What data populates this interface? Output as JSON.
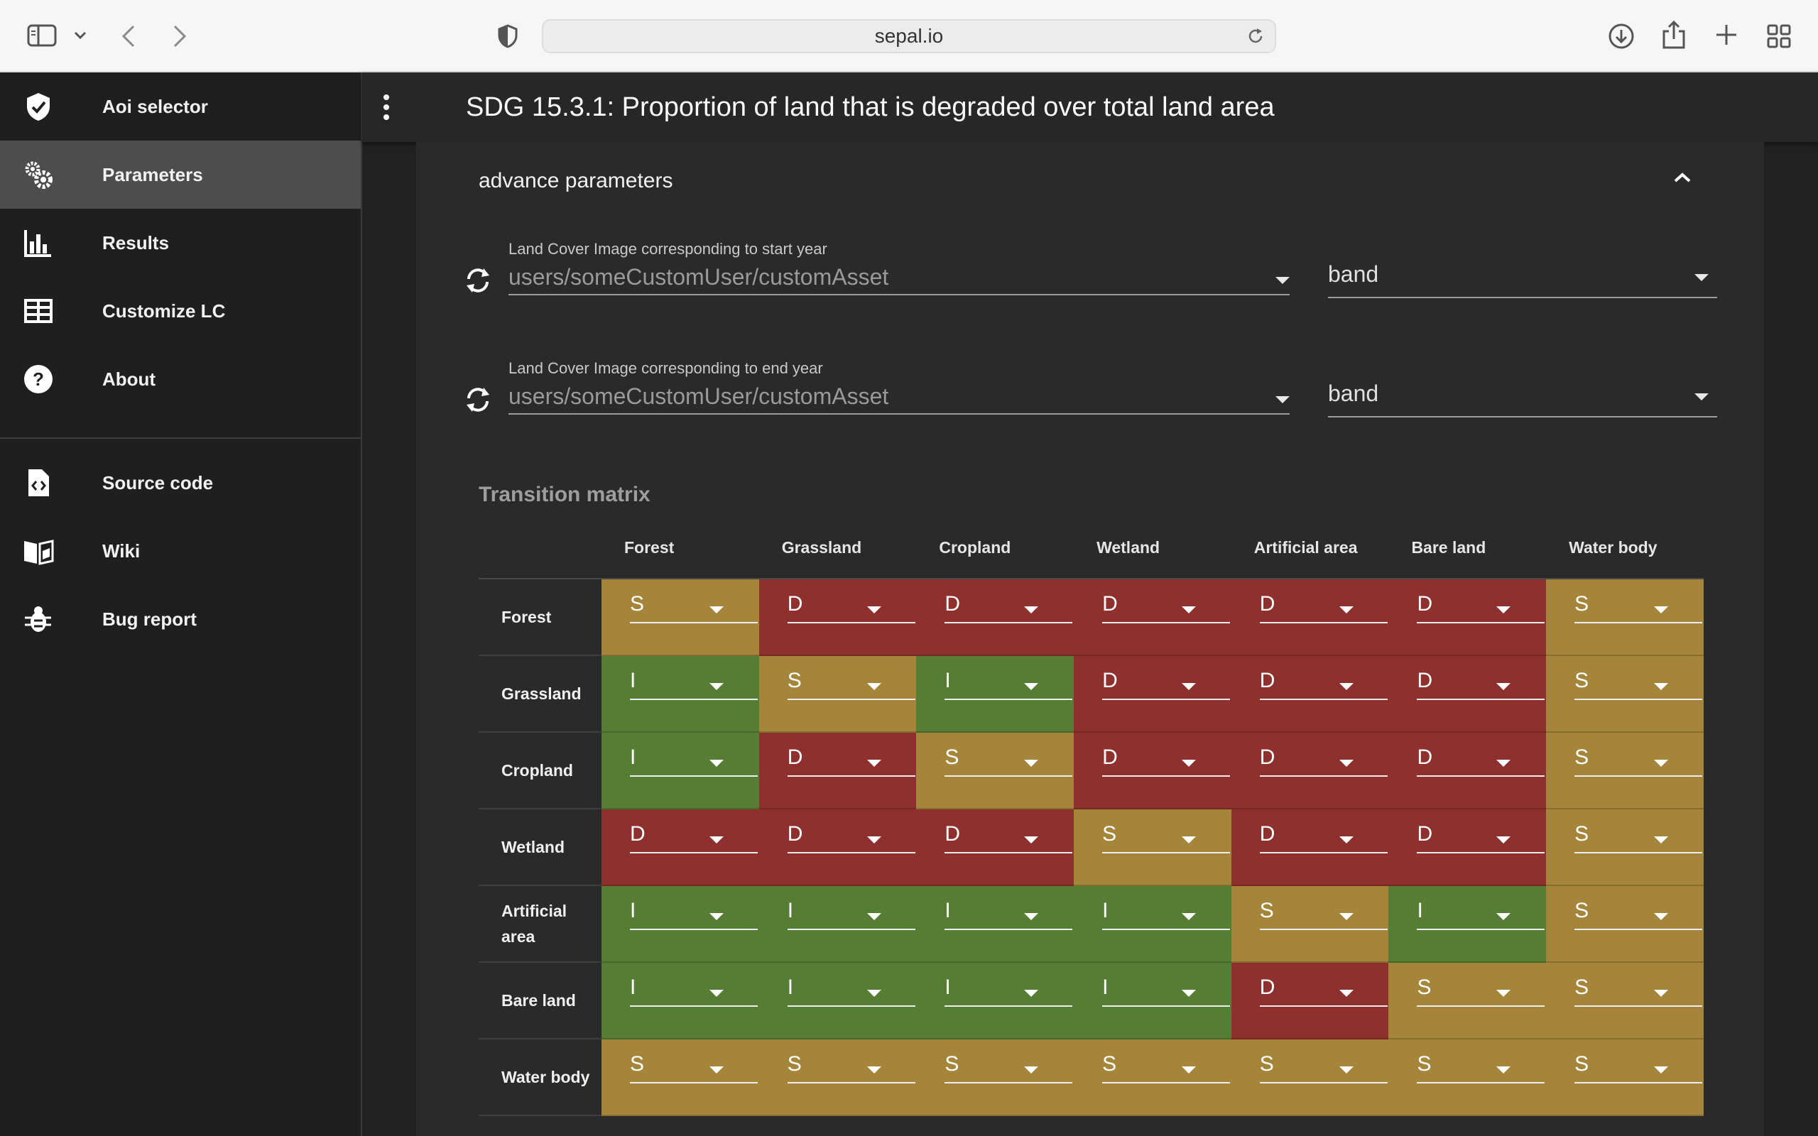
{
  "browser": {
    "url": "sepal.io"
  },
  "sidebar": {
    "items": [
      {
        "label": "Aoi selector",
        "icon": "check-badge-icon",
        "active": false
      },
      {
        "label": "Parameters",
        "icon": "gears-icon",
        "active": true
      },
      {
        "label": "Results",
        "icon": "bar-chart-icon",
        "active": false
      },
      {
        "label": "Customize LC",
        "icon": "table-icon",
        "active": false
      },
      {
        "label": "About",
        "icon": "help-circle-icon",
        "active": false
      }
    ],
    "links": [
      {
        "label": "Source code",
        "icon": "code-file-icon"
      },
      {
        "label": "Wiki",
        "icon": "book-icon"
      },
      {
        "label": "Bug report",
        "icon": "bug-icon"
      }
    ]
  },
  "appbar": {
    "title": "SDG 15.3.1: Proportion of land that is degraded over total land area"
  },
  "panel": {
    "section_title": "advance parameters",
    "start_image": {
      "label": "Land Cover Image corresponding to start year",
      "value": "users/someCustomUser/customAsset",
      "band": "band"
    },
    "end_image": {
      "label": "Land Cover Image corresponding to end year",
      "value": "users/someCustomUser/customAsset",
      "band": "band"
    },
    "matrix_title": "Transition matrix"
  },
  "colors": {
    "S": "#a4853a",
    "D": "#8e302d",
    "I": "#557e34",
    "active_nav": "#4d4d4d"
  },
  "matrix": {
    "columns": [
      "Forest",
      "Grassland",
      "Cropland",
      "Wetland",
      "Artificial area",
      "Bare land",
      "Water body"
    ],
    "rows": [
      {
        "name": "Forest",
        "values": [
          "S",
          "D",
          "D",
          "D",
          "D",
          "D",
          "S"
        ]
      },
      {
        "name": "Grassland",
        "values": [
          "I",
          "S",
          "I",
          "D",
          "D",
          "D",
          "S"
        ]
      },
      {
        "name": "Cropland",
        "values": [
          "I",
          "D",
          "S",
          "D",
          "D",
          "D",
          "S"
        ]
      },
      {
        "name": "Wetland",
        "values": [
          "D",
          "D",
          "D",
          "S",
          "D",
          "D",
          "S"
        ]
      },
      {
        "name": "Artificial area",
        "values": [
          "I",
          "I",
          "I",
          "I",
          "S",
          "I",
          "S"
        ]
      },
      {
        "name": "Bare land",
        "values": [
          "I",
          "I",
          "I",
          "I",
          "D",
          "S",
          "S"
        ]
      },
      {
        "name": "Water body",
        "values": [
          "S",
          "S",
          "S",
          "S",
          "S",
          "S",
          "S"
        ]
      }
    ]
  }
}
